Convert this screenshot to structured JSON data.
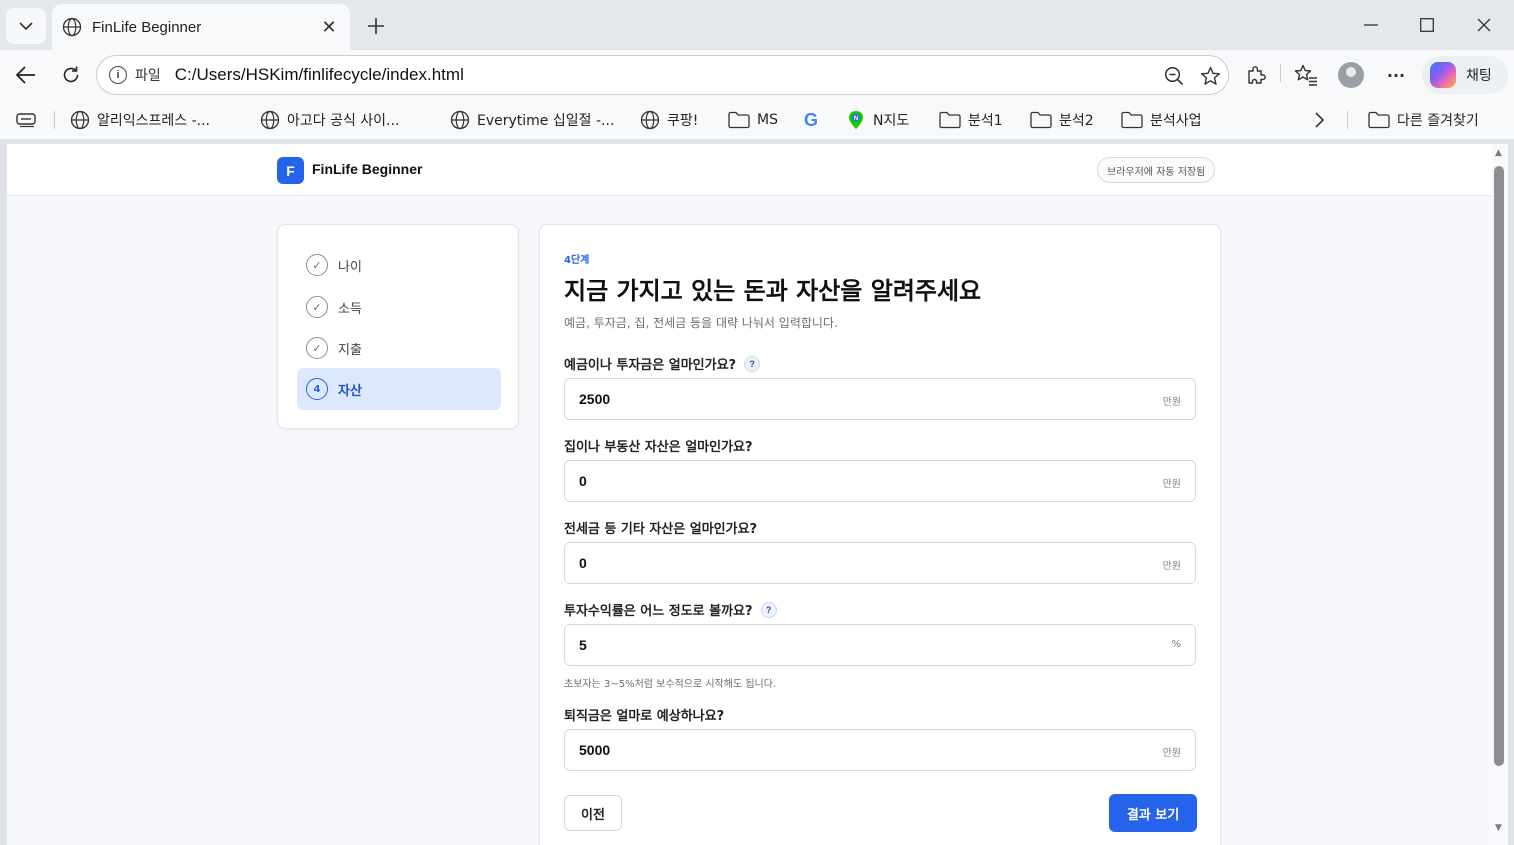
{
  "browser": {
    "tab_title": "FinLife Beginner",
    "address_label": "파일",
    "url": "C:/Users/HSKim/finlifecycle/index.html",
    "chat_label": "채팅",
    "bookmarks": [
      {
        "label": "알리익스프레스 -...",
        "icon": "globe-icon"
      },
      {
        "label": "아고다 공식 사이...",
        "icon": "globe-icon"
      },
      {
        "label": "Everytime 십일절 -...",
        "icon": "globe-icon"
      },
      {
        "label": "쿠팡!",
        "icon": "globe-icon"
      },
      {
        "label": "MS",
        "icon": "folder-icon"
      },
      {
        "label": "",
        "icon": "google-icon"
      },
      {
        "label": "N지도",
        "icon": "naver-map-icon"
      },
      {
        "label": "분석1",
        "icon": "folder-icon"
      },
      {
        "label": "분석2",
        "icon": "folder-icon"
      },
      {
        "label": "분석사업",
        "icon": "folder-icon"
      }
    ],
    "other_bookmarks": "다른 즐겨찾기"
  },
  "app": {
    "logo_letter": "F",
    "name": "FinLife Beginner",
    "save_badge": "브라우저에 자동 저장됨"
  },
  "steps": [
    {
      "label": "나이",
      "state": "done",
      "marker": "✓"
    },
    {
      "label": "소득",
      "state": "done",
      "marker": "✓"
    },
    {
      "label": "지출",
      "state": "done",
      "marker": "✓"
    },
    {
      "label": "자산",
      "state": "active",
      "marker": "4"
    }
  ],
  "form": {
    "step_tag": "4단계",
    "title": "지금 가지고 있는 돈과 자산을 알려주세요",
    "subtitle": "예금, 투자금, 집, 전세금 등을 대략 나눠서 입력합니다.",
    "questions": [
      {
        "label": "예금이나 투자금은 얼마인가요?",
        "help": "?",
        "value": "2500",
        "unit": "만원"
      },
      {
        "label": "집이나 부동산 자산은 얼마인가요?",
        "value": "0",
        "unit": "만원"
      },
      {
        "label": "전세금 등 기타 자산은 얼마인가요?",
        "value": "0",
        "unit": "만원"
      },
      {
        "label": "투자수익률은 어느 정도로 볼까요?",
        "help": "?",
        "value": "5",
        "unit": "%"
      },
      {
        "label": "퇴직금은 얼마로 예상하나요?",
        "value": "5000",
        "unit": "만원"
      }
    ],
    "return_hint": "초보자는 3~5%처럼 보수적으로 시작해도 됩니다.",
    "prev_button": "이전",
    "result_button": "결과 보기"
  },
  "colors": {
    "accent": "#2563eb",
    "active_step_bg": "#dce9fc"
  }
}
